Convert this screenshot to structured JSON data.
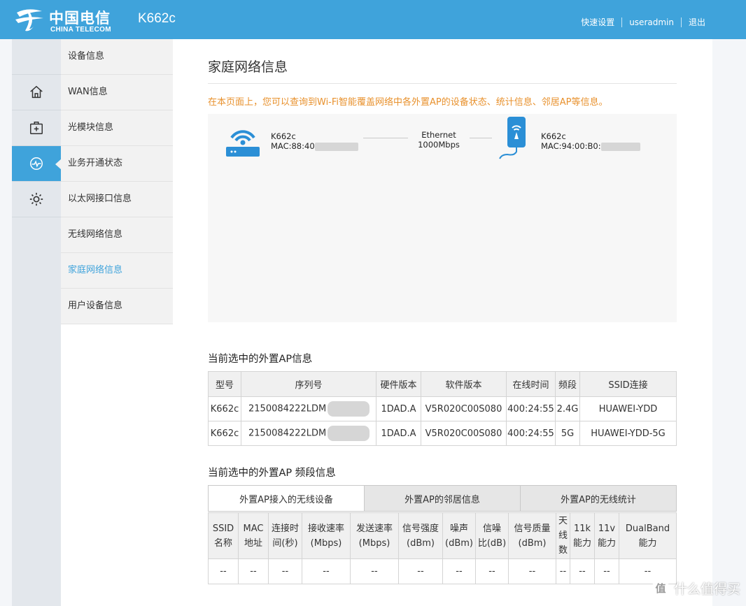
{
  "header": {
    "logo_cn": "中国电信",
    "logo_en": "CHINA TELECOM",
    "model": "K662c",
    "links": [
      "快速设置",
      "useradmin",
      "退出"
    ]
  },
  "sidebar": {
    "icons": [
      "home-icon",
      "medical-kit-icon",
      "pulse-icon",
      "gear-icon"
    ],
    "items": [
      {
        "label": "设备信息"
      },
      {
        "label": "WAN信息"
      },
      {
        "label": "光模块信息"
      },
      {
        "label": "业务开通状态"
      },
      {
        "label": "以太网接口信息"
      },
      {
        "label": "无线网络信息"
      },
      {
        "label": "家庭网络信息"
      },
      {
        "label": "用户设备信息"
      }
    ]
  },
  "main": {
    "title": "家庭网络信息",
    "notice": "在本页面上，您可以查询到Wi-Fi智能覆盖网络中各外置AP的设备状态、统计信息、邻居AP等信息。",
    "topology": {
      "gateway": {
        "name": "K662c",
        "mac": "MAC:88:40"
      },
      "link": {
        "type": "Ethernet",
        "speed": "1000Mbps"
      },
      "ap": {
        "name": "K662c",
        "mac": "MAC:94:00:B0:"
      }
    },
    "ap_section_title": "当前选中的外置AP信息",
    "ap_table": {
      "headers": [
        "型号",
        "序列号",
        "硬件版本",
        "软件版本",
        "在线时间",
        "频段",
        "SSID连接"
      ],
      "rows": [
        [
          "K662c",
          "2150084222LDM",
          "1DAD.A",
          "V5R020C00S080",
          "400:24:55",
          "2.4G",
          "HUAWEI-YDD"
        ],
        [
          "K662c",
          "2150084222LDM",
          "1DAD.A",
          "V5R020C00S080",
          "400:24:55",
          "5G",
          "HUAWEI-YDD-5G"
        ]
      ]
    },
    "band_section_title": "当前选中的外置AP 频段信息",
    "tabs": [
      {
        "label": "外置AP接入的无线设备"
      },
      {
        "label": "外置AP的邻居信息"
      },
      {
        "label": "外置AP的无线统计"
      }
    ],
    "sta_table": {
      "headers": [
        [
          "SSID",
          "名称"
        ],
        [
          "MAC",
          "地址"
        ],
        [
          "连接时",
          "间(秒)"
        ],
        [
          "接收速率",
          "(Mbps)"
        ],
        [
          "发送速率",
          "(Mbps)"
        ],
        [
          "信号强度",
          "(dBm)"
        ],
        [
          "噪声",
          "(dBm)"
        ],
        [
          "信噪",
          "比(dB)"
        ],
        [
          "信号质量",
          "(dBm)"
        ],
        [
          "天",
          "线",
          "数"
        ],
        [
          "11k",
          "能力"
        ],
        [
          "11v",
          "能力"
        ],
        [
          "DualBand",
          "能力"
        ]
      ],
      "row": [
        "--",
        "--",
        "--",
        "--",
        "--",
        "--",
        "--",
        "--",
        "--",
        "--",
        "--",
        "--",
        "--"
      ]
    }
  },
  "watermark": {
    "glyph": "值",
    "text": "什么值得买"
  },
  "colors": {
    "header_bg": "#3fa3db",
    "accent": "#3fa3db",
    "notice": "#e8912d"
  }
}
